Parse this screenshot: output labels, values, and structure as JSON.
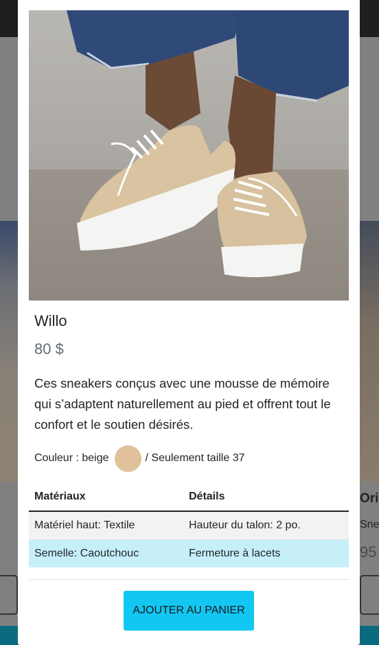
{
  "background": {
    "right_card": {
      "name": "Ori",
      "category": "Sne",
      "price": "95"
    }
  },
  "modal": {
    "product": {
      "name": "Willo",
      "price": "80 $",
      "description": "Ces sneakers conçus avec une mousse de mémoire qui s’adaptent naturellement au pied et offrent tout le confort et le soutien désirés.",
      "color_label": "Couleur : beige",
      "color_hex": "#dfc29c",
      "size_text": "/ Seulement taille 37"
    },
    "table": {
      "headers": [
        "Matériaux",
        "Détails"
      ],
      "rows": [
        [
          "Matériel haut: Textile",
          "Hauteur du talon: 2 po."
        ],
        [
          "Semelle: Caoutchouc",
          "Fermeture à lacets"
        ]
      ]
    },
    "add_to_cart_label": "AJOUTER AU PANIER"
  },
  "colors": {
    "accent": "#12c7f2",
    "info_row": "#c6effa",
    "striped_row": "#f2f2f2",
    "price_text": "#5f6b78"
  }
}
